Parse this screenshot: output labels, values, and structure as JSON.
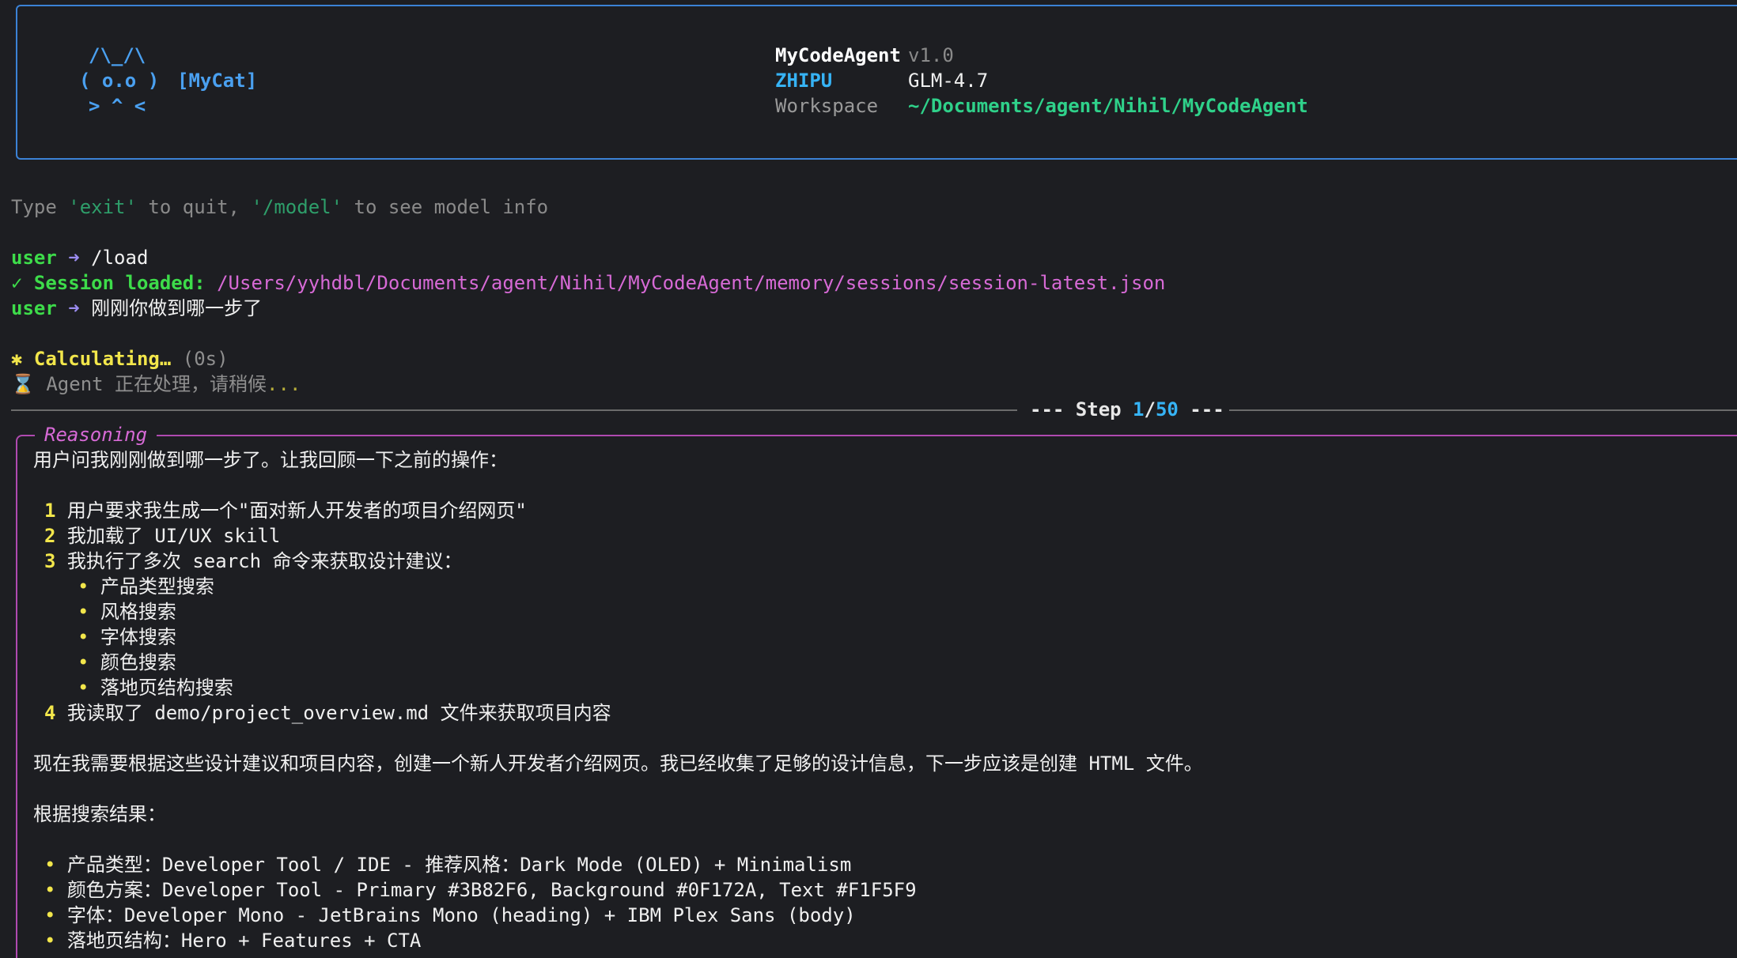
{
  "header": {
    "cat_line1": "/\\_/\\",
    "cat_line2": "( o.o )",
    "cat_line3": "> ^ <",
    "cat_tag": "[MyCat]",
    "app_name": "MyCodeAgent",
    "version": "v1.0",
    "provider": "ZHIPU",
    "model": "GLM-4.7",
    "workspace_label": "Workspace",
    "workspace_path": "~/Documents/agent/Nihil/MyCodeAgent"
  },
  "hint": {
    "prefix": "Type ",
    "exit_cmd": "'exit'",
    "middle": " to quit, ",
    "model_cmd": "'/model'",
    "suffix": " to see model info"
  },
  "log": {
    "user_label": "user",
    "arrow": "➜",
    "cmd1": "/load",
    "session_label": "✓ Session loaded:",
    "session_path": "/Users/yyhdbl/Documents/agent/Nihil/MyCodeAgent/memory/sessions/session-latest.json",
    "cmd2": "刚刚你做到哪一步了",
    "calc_label": "✱ Calculating…",
    "calc_time": "(0s)",
    "processing_icon": "⌛",
    "processing_text": "Agent 正在处理，请稍候",
    "processing_dots": "..."
  },
  "step": {
    "prefix": "--- Step ",
    "current": "1",
    "sep": "/",
    "total": "50",
    "suffix": " ---"
  },
  "reasoning": {
    "title": "Reasoning",
    "intro": "用户问我刚刚做到哪一步了。让我回顾一下之前的操作：",
    "steps": [
      {
        "n": "1",
        "text": "用户要求我生成一个\"面对新人开发者的项目介绍网页\""
      },
      {
        "n": "2",
        "text": "我加载了 UI/UX skill"
      },
      {
        "n": "3",
        "text": "我执行了多次 search 命令来获取设计建议："
      },
      {
        "n": "4",
        "text": "我读取了 demo/project_overview.md 文件来获取项目内容"
      }
    ],
    "sub_items": [
      "产品类型搜索",
      "风格搜索",
      "字体搜索",
      "颜色搜索",
      "落地页结构搜索"
    ],
    "para": "现在我需要根据这些设计建议和项目内容，创建一个新人开发者介绍网页。我已经收集了足够的设计信息，下一步应该是创建 HTML 文件。",
    "results_label": "根据搜索结果：",
    "results": [
      "产品类型：Developer Tool / IDE - 推荐风格：Dark Mode (OLED) + Minimalism",
      "颜色方案：Developer Tool - Primary #3B82F6, Background #0F172A, Text #F1F5F9",
      "字体：Developer Mono - JetBrains Mono (heading) + IBM Plex Sans (body)",
      "落地页结构：Hero + Features + CTA"
    ]
  }
}
